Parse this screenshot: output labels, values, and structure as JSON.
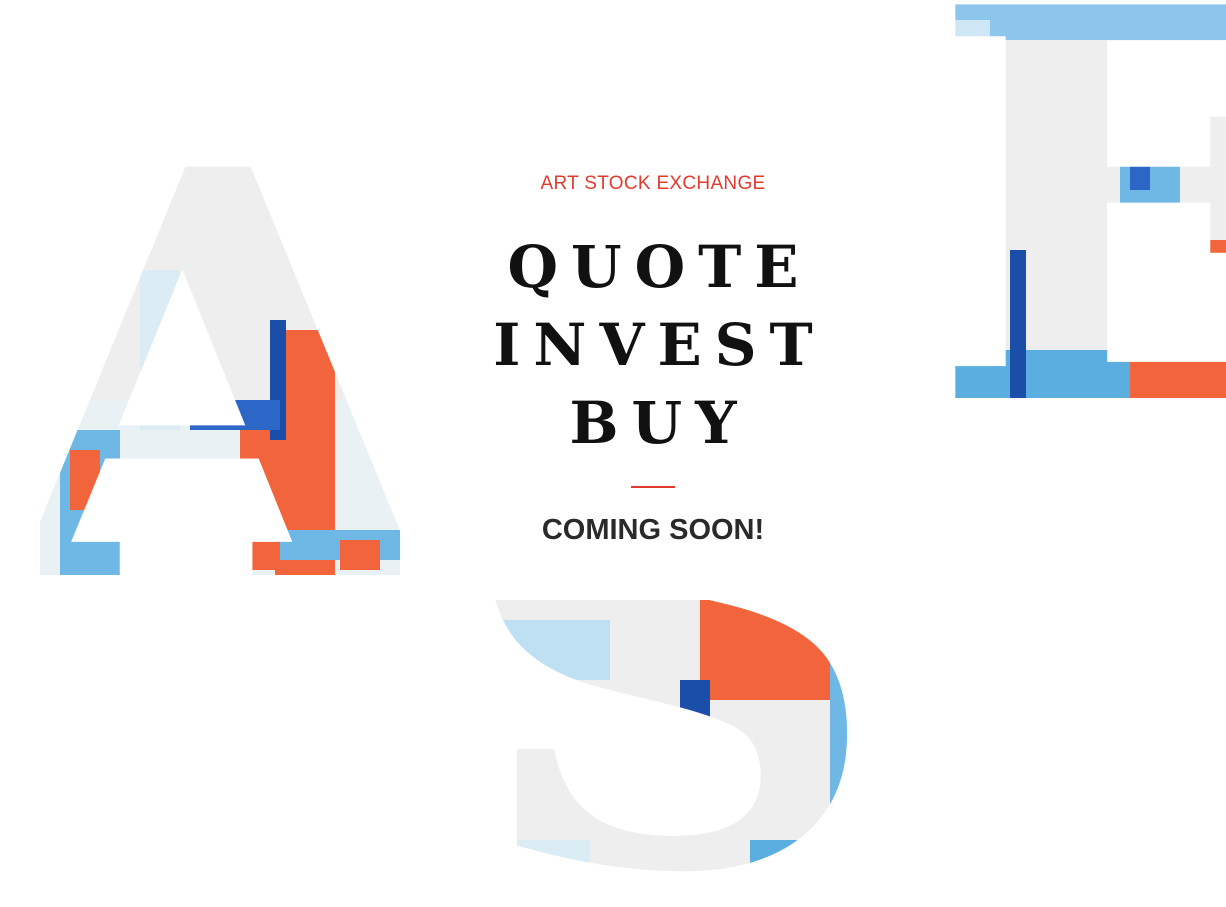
{
  "brand": {
    "eyebrow": "ART STOCK EXCHANGE"
  },
  "headline": {
    "lines": [
      "QUOTE",
      "INVEST",
      "BUY"
    ]
  },
  "status": {
    "label": "COMING SOON!"
  },
  "decor": {
    "letters": [
      "A",
      "E",
      "S"
    ]
  },
  "colors": {
    "accent": "#e23b2e",
    "text": "#111111",
    "paint_blue": "#3a9ad9",
    "paint_orange": "#f2643c",
    "paint_white": "#eeeeee"
  }
}
